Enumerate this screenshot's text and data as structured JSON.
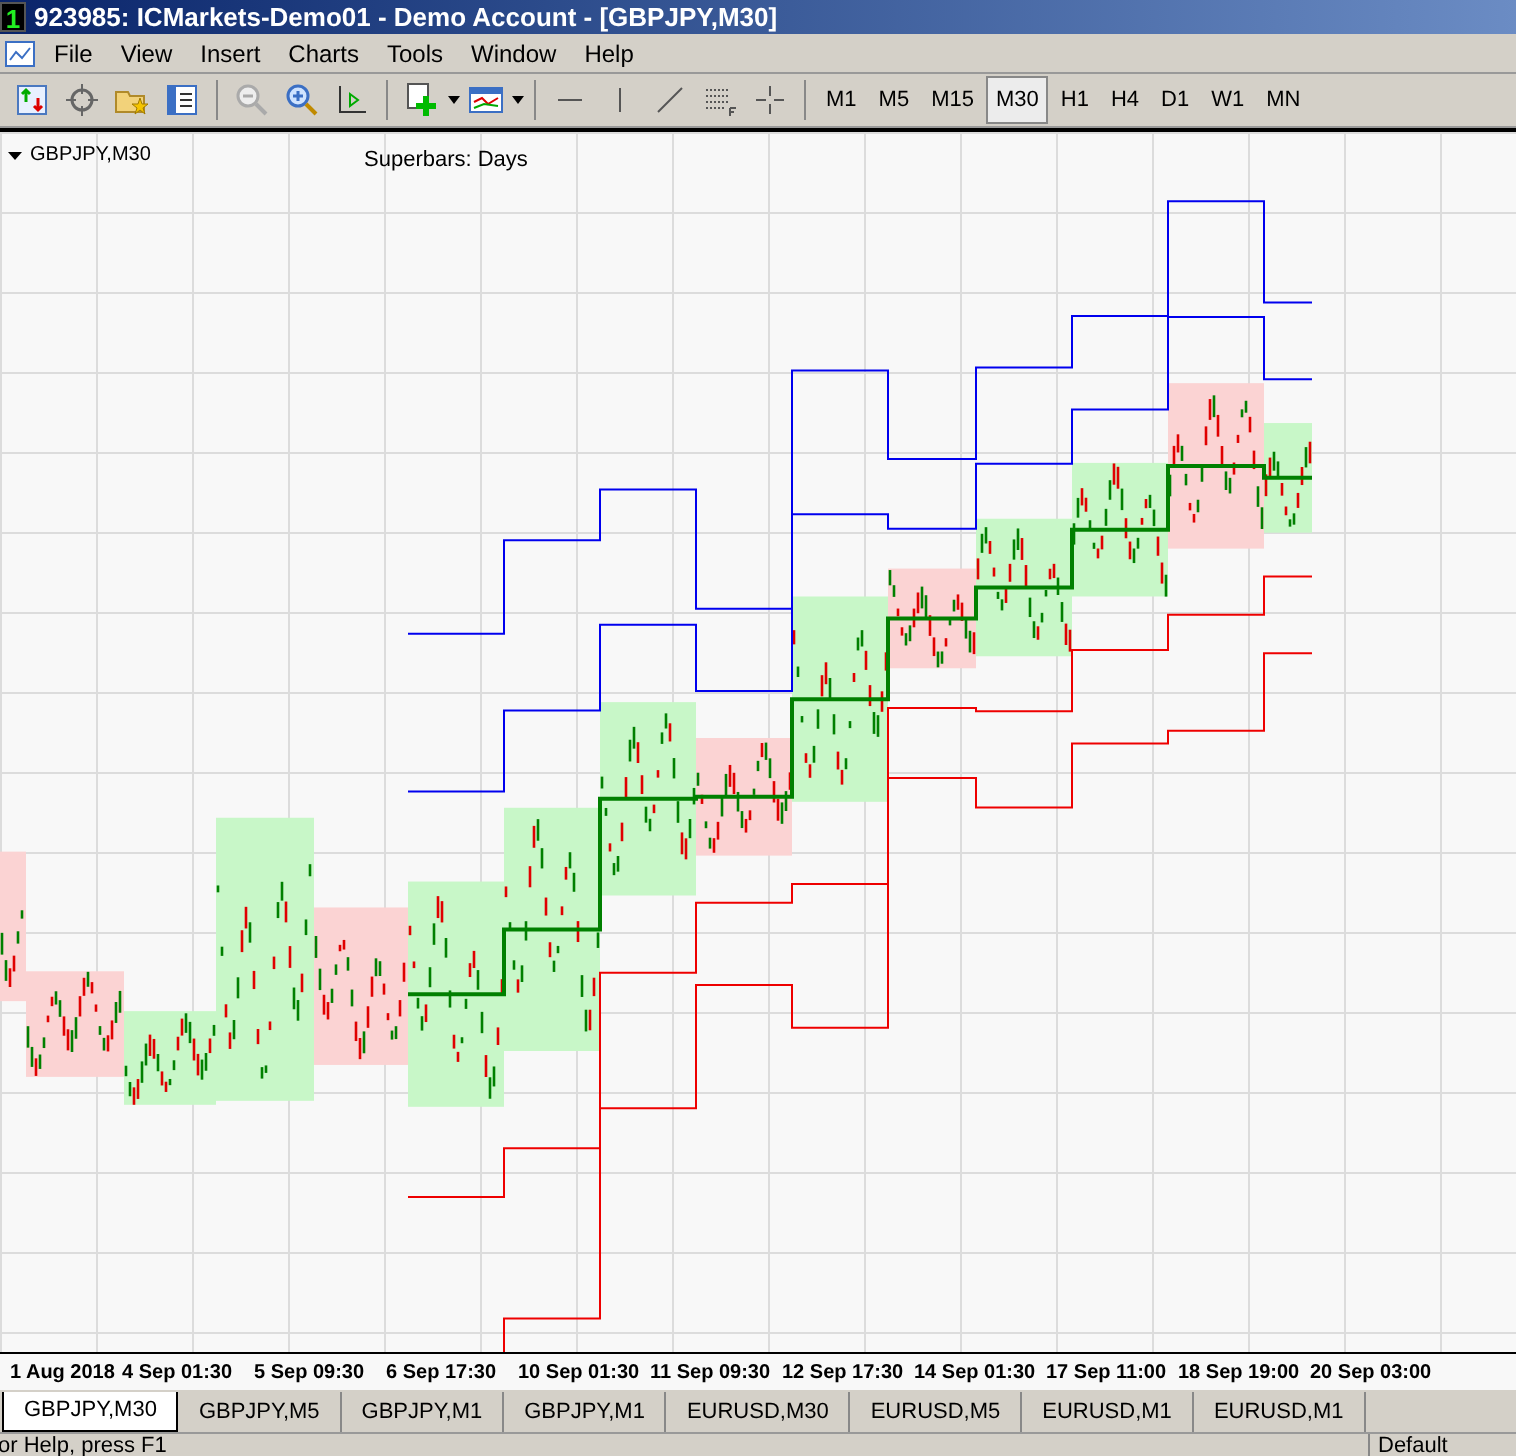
{
  "window": {
    "icon_text": "1",
    "title": "923985: ICMarkets-Demo01 - Demo Account - [GBPJPY,M30]"
  },
  "menu": [
    "File",
    "View",
    "Insert",
    "Charts",
    "Tools",
    "Window",
    "Help"
  ],
  "timeframes": [
    {
      "label": "M1",
      "selected": false
    },
    {
      "label": "M5",
      "selected": false
    },
    {
      "label": "M15",
      "selected": false
    },
    {
      "label": "M30",
      "selected": true
    },
    {
      "label": "H1",
      "selected": false
    },
    {
      "label": "H4",
      "selected": false
    },
    {
      "label": "D1",
      "selected": false
    },
    {
      "label": "W1",
      "selected": false
    },
    {
      "label": "MN",
      "selected": false
    }
  ],
  "chart": {
    "symbol": "GBPJPY,M30",
    "indicator": "Superbars: Days",
    "time_labels": [
      "1 Aug 2018",
      "4 Sep 01:30",
      "5 Sep 09:30",
      "6 Sep 17:30",
      "10 Sep 01:30",
      "11 Sep 09:30",
      "12 Sep 17:30",
      "14 Sep 01:30",
      "17 Sep 11:00",
      "18 Sep 19:00",
      "20 Sep 03:00"
    ]
  },
  "tabs": [
    {
      "label": "GBPJPY,M30",
      "selected": true
    },
    {
      "label": "GBPJPY,M5",
      "selected": false
    },
    {
      "label": "GBPJPY,M1",
      "selected": false
    },
    {
      "label": "GBPJPY,M1",
      "selected": false
    },
    {
      "label": "EURUSD,M30",
      "selected": false
    },
    {
      "label": "EURUSD,M5",
      "selected": false
    },
    {
      "label": "EURUSD,M1",
      "selected": false
    },
    {
      "label": "EURUSD,M1",
      "selected": false
    }
  ],
  "status_bar": {
    "help": "or Help, press F1",
    "profile": "Default"
  }
}
